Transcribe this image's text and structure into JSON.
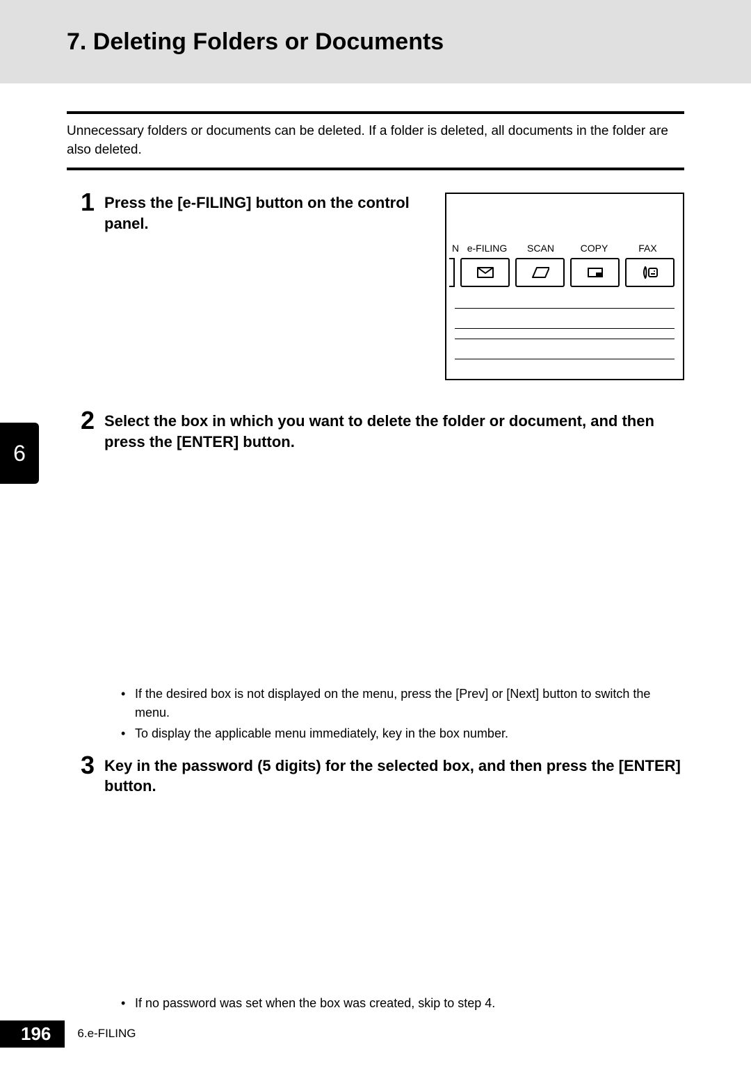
{
  "header": {
    "title": "7. Deleting Folders or Documents"
  },
  "intro": "Unnecessary folders or documents can be deleted. If a folder is deleted, all documents in the folder are also deleted.",
  "steps": [
    {
      "number": "1",
      "title": "Press the [e-FILING] button on the control panel."
    },
    {
      "number": "2",
      "title": "Select the box in which you want to delete the folder or document, and then press the [ENTER] button.",
      "bullets": [
        "If the desired box is not displayed on the menu, press the [Prev] or [Next] button to switch the menu.",
        "To display the applicable menu immediately, key in the box number."
      ]
    },
    {
      "number": "3",
      "title": "Key in the password (5 digits) for the selected box, and then press the [ENTER] button.",
      "bullets": [
        "If no password was set when the box was created, skip to step 4."
      ]
    }
  ],
  "panel": {
    "n": "N",
    "labels": [
      "e-FILING",
      "SCAN",
      "COPY",
      "FAX"
    ]
  },
  "chapterTab": "6",
  "footer": {
    "pageNumber": "196",
    "label": "6.e-FILING"
  }
}
